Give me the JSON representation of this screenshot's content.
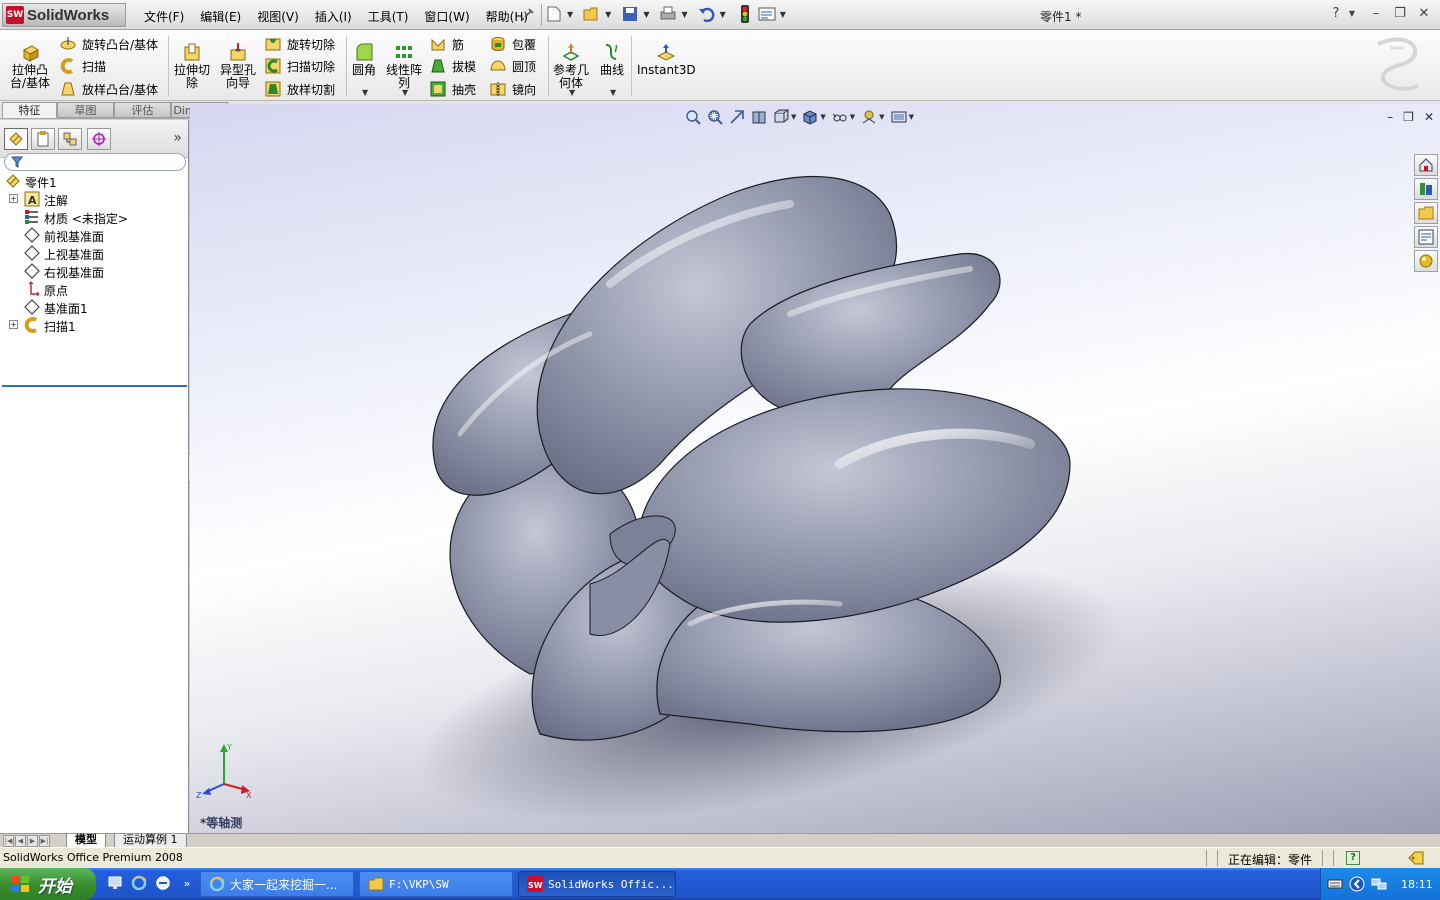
{
  "app": {
    "logo_text": "SolidWorks",
    "document_title": "零件1 *"
  },
  "menu": [
    "文件(F)",
    "编辑(E)",
    "视图(V)",
    "插入(I)",
    "工具(T)",
    "窗口(W)",
    "帮助(H)"
  ],
  "window_controls": {
    "help": "?",
    "minimize": "–",
    "restore": "❐",
    "close": "✕"
  },
  "command_manager": {
    "extrude_boss": "拉伸凸\n台/基体",
    "revolve_boss": "旋转凸台/基体",
    "sweep": "扫描",
    "loft_boss": "放样凸台/基体",
    "extrude_cut": "拉伸切\n除",
    "hole_wizard": "异型孔\n向导",
    "revolve_cut": "旋转切除",
    "sweep_cut": "扫描切除",
    "loft_cut": "放样切割",
    "fillet": "圆角",
    "linear_pattern": "线性阵\n列",
    "rib": "筋",
    "draft": "拔模",
    "shell": "抽壳",
    "wrap": "包覆",
    "dome": "圆顶",
    "mirror": "镜向",
    "reference_geometry": "参考几\n何体",
    "curves": "曲线",
    "instant3d": "Instant3D"
  },
  "command_tabs": [
    "特征",
    "草图",
    "评估",
    "DimXpert"
  ],
  "feature_tree": {
    "root": "零件1",
    "items": [
      {
        "label": "注解",
        "icon": "annotations-icon",
        "expandable": true
      },
      {
        "label": "材质 <未指定>",
        "icon": "material-icon",
        "expandable": false
      },
      {
        "label": "前视基准面",
        "icon": "plane-icon",
        "expandable": false
      },
      {
        "label": "上视基准面",
        "icon": "plane-icon",
        "expandable": false
      },
      {
        "label": "右视基准面",
        "icon": "plane-icon",
        "expandable": false
      },
      {
        "label": "原点",
        "icon": "origin-icon",
        "expandable": false
      },
      {
        "label": "基准面1",
        "icon": "plane-icon",
        "expandable": false
      },
      {
        "label": "扫描1",
        "icon": "sweep-feature-icon",
        "expandable": true
      }
    ]
  },
  "viewport": {
    "view_name": "*等轴测",
    "triad_labels": {
      "x": "X",
      "y": "Y",
      "z": "Z"
    }
  },
  "bottom_tabs": [
    "模型",
    "运动算例 1"
  ],
  "status": {
    "left": "SolidWorks Office Premium 2008",
    "right": "正在编辑：零件",
    "help": "?"
  },
  "taskbar": {
    "start_label": "开始",
    "buttons": [
      {
        "label": "大家一起来挖掘一...",
        "icon": "ie-icon"
      },
      {
        "label": "F:\\VKP\\SW",
        "icon": "folder-icon"
      },
      {
        "label": "SolidWorks Offic...",
        "icon": "solidworks-icon"
      }
    ],
    "clock": "18:11"
  },
  "colors": {
    "accent_blue": "#245edc",
    "solidworks_red": "#c8102e",
    "model_gray": "#8d91a6"
  }
}
